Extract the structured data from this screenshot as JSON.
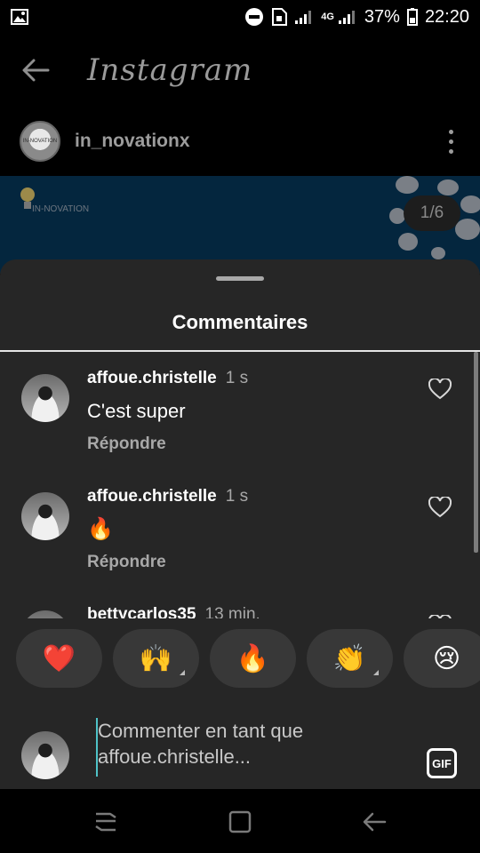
{
  "status": {
    "battery_text": "37%",
    "time": "22:20",
    "network": "4G"
  },
  "header": {
    "app_name": "Instagram"
  },
  "post": {
    "username": "in_novationx",
    "avatar_text": "IN-NOVATION",
    "watermark_text": "IN-NOVATION",
    "counter": "1/6"
  },
  "sheet": {
    "title": "Commentaires"
  },
  "comments": [
    {
      "user": "affoue.christelle",
      "time": "1 s",
      "text": "C'est super",
      "reply": "Répondre"
    },
    {
      "user": "affoue.christelle",
      "time": "1 s",
      "text": "🔥",
      "reply": "Répondre"
    },
    {
      "user": "bettycarlos35",
      "time": "13 min.",
      "text": "",
      "reply": ""
    }
  ],
  "reactions": [
    {
      "emoji": "❤️",
      "name": "red-heart-reaction",
      "has_skin": false
    },
    {
      "emoji": "🙌",
      "name": "raising-hands-reaction",
      "has_skin": true
    },
    {
      "emoji": "🔥",
      "name": "fire-reaction",
      "has_skin": false
    },
    {
      "emoji": "👏",
      "name": "clapping-hands-reaction",
      "has_skin": true
    },
    {
      "emoji": "😢",
      "name": "crying-face-reaction",
      "has_skin": false
    }
  ],
  "input": {
    "placeholder": "Commenter en tant que affoue.christelle...",
    "gif_label": "GIF"
  },
  "colors": {
    "sheet_bg": "#262626",
    "reaction_bg": "#383838",
    "post_bg": "#04263e",
    "cursor": "#4fc3c8"
  }
}
